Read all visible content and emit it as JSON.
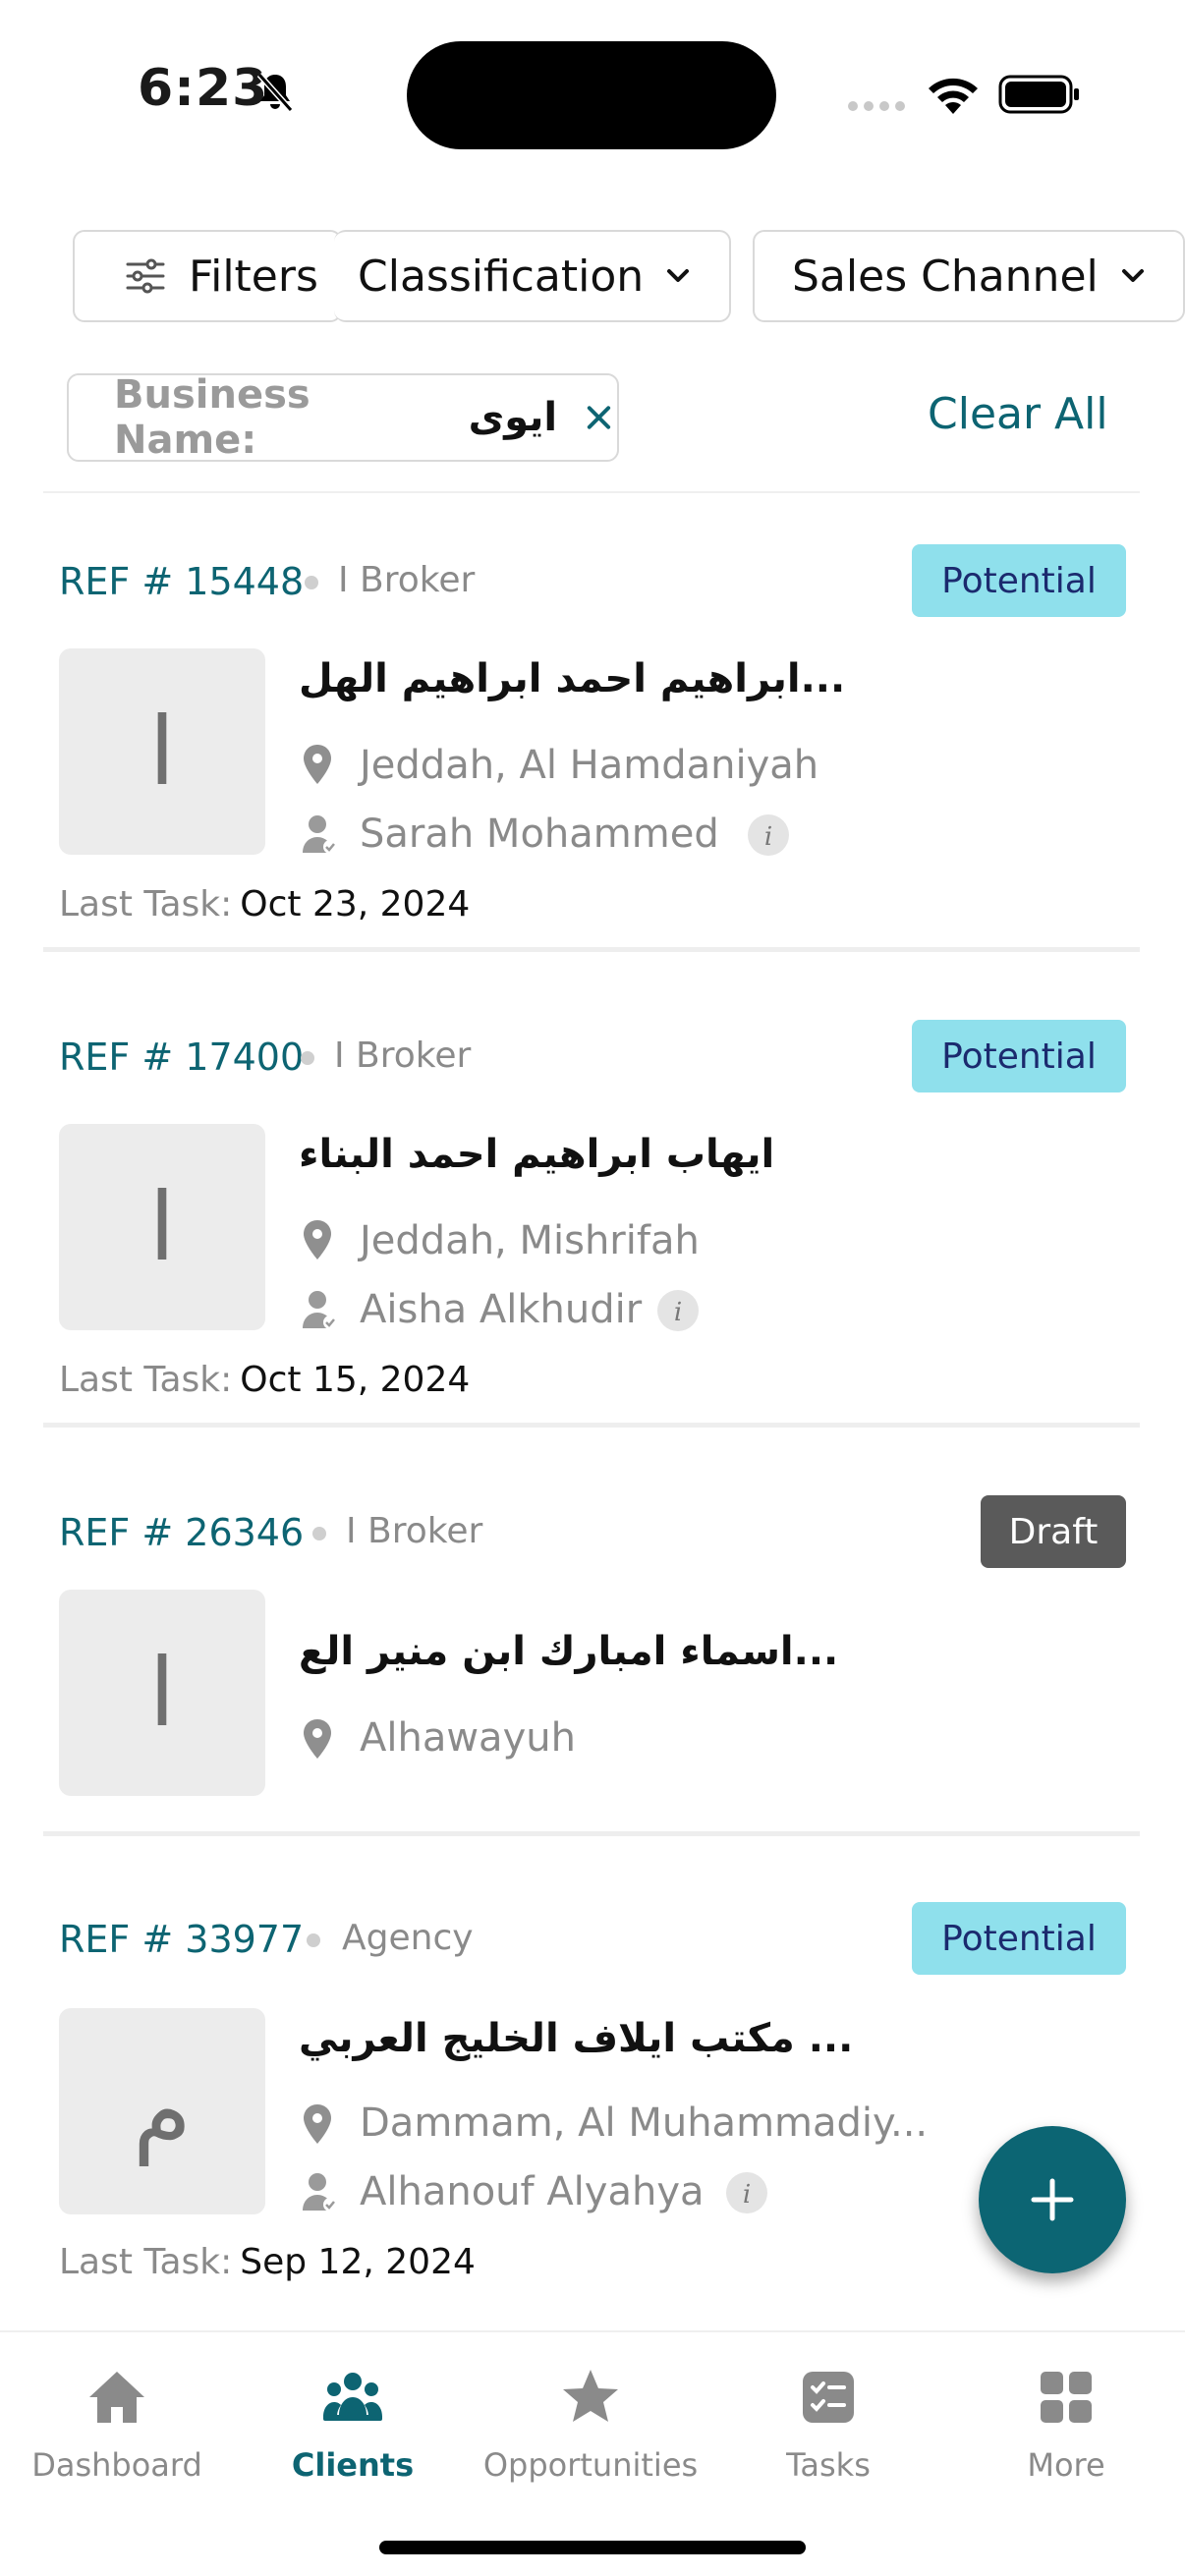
{
  "status_bar": {
    "time": "6:23"
  },
  "filters": {
    "filters_label": "Filters",
    "classification_label": "Classification",
    "sales_channel_label": "Sales Channel"
  },
  "active_filter": {
    "label": "Business Name:",
    "value": "ايوى",
    "clear_all": "Clear All"
  },
  "cards": [
    {
      "ref": "REF # 15448",
      "type": "I Broker",
      "status": "Potential",
      "avatar": "ا",
      "name": "ابراهيم احمد ابراهيم الهل...",
      "location": "Jeddah, Al Hamdaniyah",
      "user": "Sarah Mohammed",
      "last_task_label": "Last Task:",
      "last_task_date": "Oct 23, 2024"
    },
    {
      "ref": "REF # 17400",
      "type": "I Broker",
      "status": "Potential",
      "avatar": "ا",
      "name": "ايهاب ابراهيم احمد البناء",
      "location": "Jeddah, Mishrifah",
      "user": "Aisha Alkhudir",
      "last_task_label": "Last Task:",
      "last_task_date": "Oct 15, 2024"
    },
    {
      "ref": "REF # 26346",
      "type": "I Broker",
      "status": "Draft",
      "avatar": "ا",
      "name": "اسماء امبارك ابن منير الع...",
      "location": "Alhawayuh"
    },
    {
      "ref": "REF # 33977",
      "type": "Agency",
      "status": "Potential",
      "avatar": "م",
      "name": "مكتب ايلاف الخليج العربي ...",
      "location": "Dammam, Al Muhammadiy...",
      "user": "Alhanouf Alyahya",
      "last_task_label": "Last Task:",
      "last_task_date": "Sep 12, 2024"
    }
  ],
  "nav": {
    "dashboard": "Dashboard",
    "clients": "Clients",
    "opportunities": "Opportunities",
    "tasks": "Tasks",
    "more": "More"
  },
  "colors": {
    "accent": "#0d6472",
    "potential_bg": "#8fe0ec",
    "draft_bg": "#5a5a5a"
  }
}
